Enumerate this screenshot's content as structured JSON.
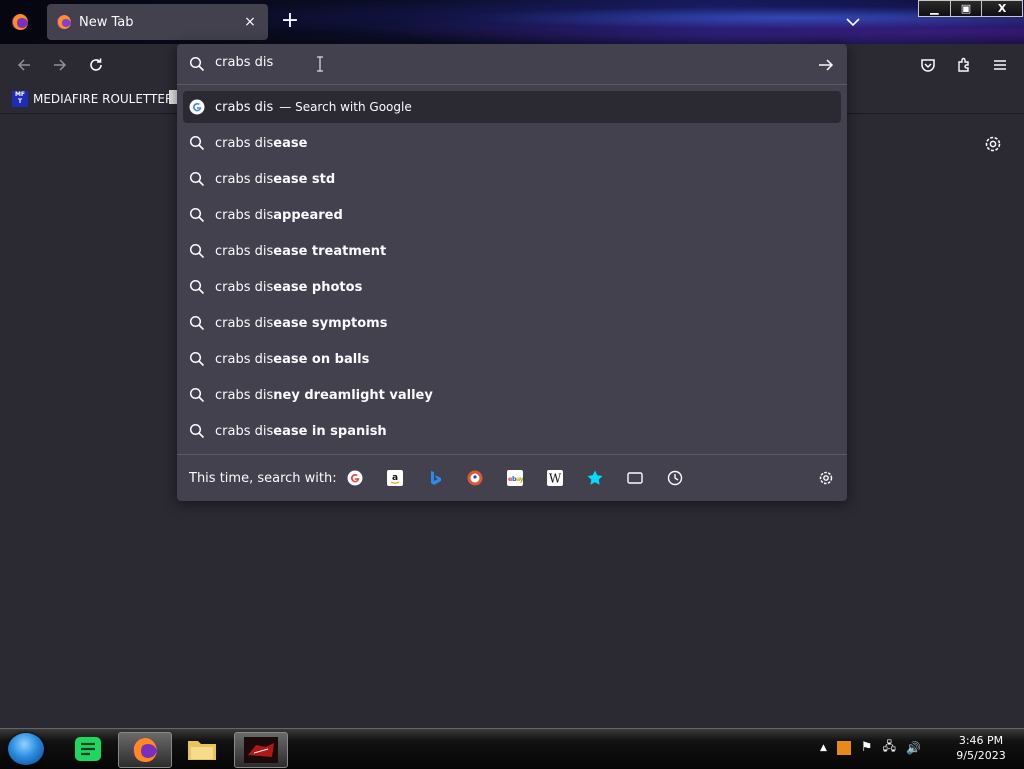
{
  "browser": {
    "tab": {
      "title": "New Tab",
      "close": "×"
    },
    "new_tab": "+"
  },
  "window_controls": {
    "minimize": "▁",
    "maximize": "▣",
    "close": "X"
  },
  "bookmarks": [
    {
      "label": "MEDIAFIRE ROULETTER",
      "favicon_text": "MF T"
    }
  ],
  "urlbar": {
    "value": "crabs dis",
    "heuristic": {
      "query": "crabs dis",
      "action": "— Search with Google"
    },
    "suggestions": [
      {
        "typed": "crabs dis",
        "completion": "ease"
      },
      {
        "typed": "crabs dis",
        "completion": "ease std"
      },
      {
        "typed": "crabs dis",
        "completion": "appeared"
      },
      {
        "typed": "crabs dis",
        "completion": "ease treatment"
      },
      {
        "typed": "crabs dis",
        "completion": "ease photos"
      },
      {
        "typed": "crabs dis",
        "completion": "ease symptoms"
      },
      {
        "typed": "crabs dis",
        "completion": "ease on balls"
      },
      {
        "typed": "crabs dis",
        "completion": "ney dreamlight valley"
      },
      {
        "typed": "crabs dis",
        "completion": "ease in spanish"
      }
    ],
    "one_off_label": "This time, search with:",
    "engines": [
      "google-icon",
      "amazon-icon",
      "bing-icon",
      "duckduckgo-icon",
      "ebay-icon",
      "wikipedia-icon",
      "bookmarks-star-icon",
      "tabs-icon",
      "history-icon"
    ]
  },
  "taskbar": {
    "clock_time": "3:46 PM",
    "clock_date": "9/5/2023"
  },
  "colors": {
    "toolbar": "#2b2a33",
    "panel": "#42414d",
    "accent": "#00ddff"
  }
}
